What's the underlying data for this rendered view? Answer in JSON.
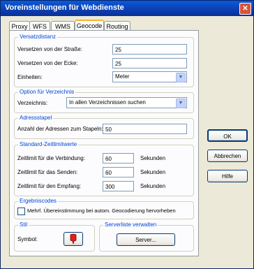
{
  "window": {
    "title": "Voreinstellungen für Webdienste",
    "close_glyph": "✕"
  },
  "tabs": [
    {
      "label": "Proxy"
    },
    {
      "label": "WFS"
    },
    {
      "label": "WMS"
    },
    {
      "label": "Geocode"
    },
    {
      "label": "Routing"
    }
  ],
  "active_tab": "Geocode",
  "versatzdistanz": {
    "legend": "Versatzdistanz",
    "street_label": "Versetzen von der Straße:",
    "street_value": "25",
    "corner_label": "Versetzen von der Ecke:",
    "corner_value": "25",
    "units_label": "Einheiten:",
    "units_value": "Meter"
  },
  "verzeichnis": {
    "legend": "Option für Verzeichnis",
    "label": "Verzeichnis:",
    "value": "In allen Verzeichnissen suchen"
  },
  "adressstapel": {
    "legend": "Adressstapel",
    "label": "Anzahl der Adressen zum Stapeln:",
    "value": "50"
  },
  "zeitlimit": {
    "legend": "Standard-Zeitlimitwerte",
    "connection_label": "Zeitlimit für die Verbindung:",
    "connection_value": "60",
    "send_label": "Zeitlimit für das Senden:",
    "send_value": "60",
    "receive_label": "Zeitlimit für den Empfang:",
    "receive_value": "300",
    "unit": "Sekunden"
  },
  "ergebniscodes": {
    "legend": "Ergebniscodes",
    "checkbox_label": "Mehrf. Übereinstimmung bei autom. Geocodierung hervorheben",
    "checked": false
  },
  "stil": {
    "legend": "Stil",
    "symbol_label": "Symbol:"
  },
  "serverliste": {
    "legend": "Serverliste verwalten",
    "button_label": "Server..."
  },
  "buttons": {
    "ok": "OK",
    "cancel": "Abbrechen",
    "help": "Hilfe"
  },
  "colors": {
    "title_bar": "#0b3fb0",
    "legend_text": "#0046d5",
    "symbol": "#e0201e"
  }
}
